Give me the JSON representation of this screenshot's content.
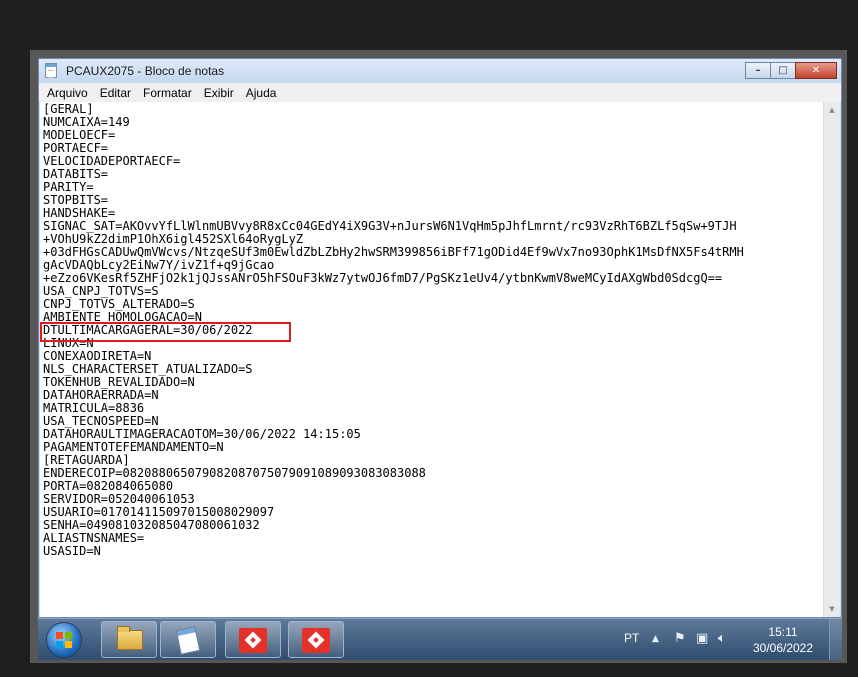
{
  "window": {
    "title": "PCAUX2075 - Bloco de notas",
    "minimize_glyph": "–",
    "maximize_glyph": "□",
    "close_glyph": "✕"
  },
  "menu": [
    "Arquivo",
    "Editar",
    "Formatar",
    "Exibir",
    "Ajuda"
  ],
  "document": {
    "lines": [
      "[GERAL]",
      "NUMCAIXA=149",
      "MODELOECF=",
      "PORTAECF=",
      "VELOCIDADEPORTAECF=",
      "DATABITS=",
      "PARITY=",
      "STOPBITS=",
      "HANDSHAKE=",
      "SIGNAC_SAT=AKOvvYfLlWlnmUBVvy8R8xCc04GEdY4iX9G3V+nJursW6N1VqHm5pJhfLmrnt/rc93VzRhT6BZLf5qSw+9TJH",
      "+VOhU9kZ2dimP1OhX6igl452SXl64oRygLyZ",
      "+03dFHGsCADUwQmVWcvs/NtzqeSUf3m0EwldZbLZbHy2hwSRM399856iBFf71gODid4Ef9wVx7no93OphK1MsDfNX5Fs4tRMH",
      "gAcVDAQbLcy2EiNw7Y/ivZ1f+q9jGcao",
      "+eZzo6VKesRf5ZHFjO2k1jQJssANrO5hFSOuF3kWz7ytwOJ6fmD7/PgSKz1eUv4/ytbnKwmV8weMCyIdAXgWbd0SdcgQ==",
      "USA_CNPJ_TOTVS=S",
      "CNPJ_TOTVS_ALTERADO=S",
      "AMBIENTE_HOMOLOGACAO=N",
      "DTULTIMACARGAGERAL=30/06/2022",
      "LINUX=N",
      "CONEXAODIRETA=N",
      "NLS_CHARACTERSET_ATUALIZADO=S",
      "TOKENHUB_REVALIDADO=N",
      "DATAHORAERRADA=N",
      "MATRICULA=8836",
      "USA_TECNOSPEED=N",
      "DATAHORAULTIMAGERACAOTOM=30/06/2022 14:15:05",
      "PAGAMENTOTEFEMANDAMENTO=N",
      "[RETAGUARDA]",
      "ENDERECOIP=082088065079082087075079091089093083083088",
      "PORTA=082084065080",
      "SERVIDOR=052040061053",
      "USUARIO=017014115097015008029097",
      "SENHA=049081032085047080061032",
      "ALIASTNSNAMES=",
      "USASID=N"
    ]
  },
  "highlight_color": "#e01b1b",
  "taskbar": {
    "apps": [
      "start-orb",
      "folder-icon",
      "notepad-icon",
      "anydesk-icon",
      "anydesk-icon"
    ],
    "language": "PT",
    "tray_arrow": "▲",
    "time": "15:11",
    "date": "30/06/2022"
  }
}
